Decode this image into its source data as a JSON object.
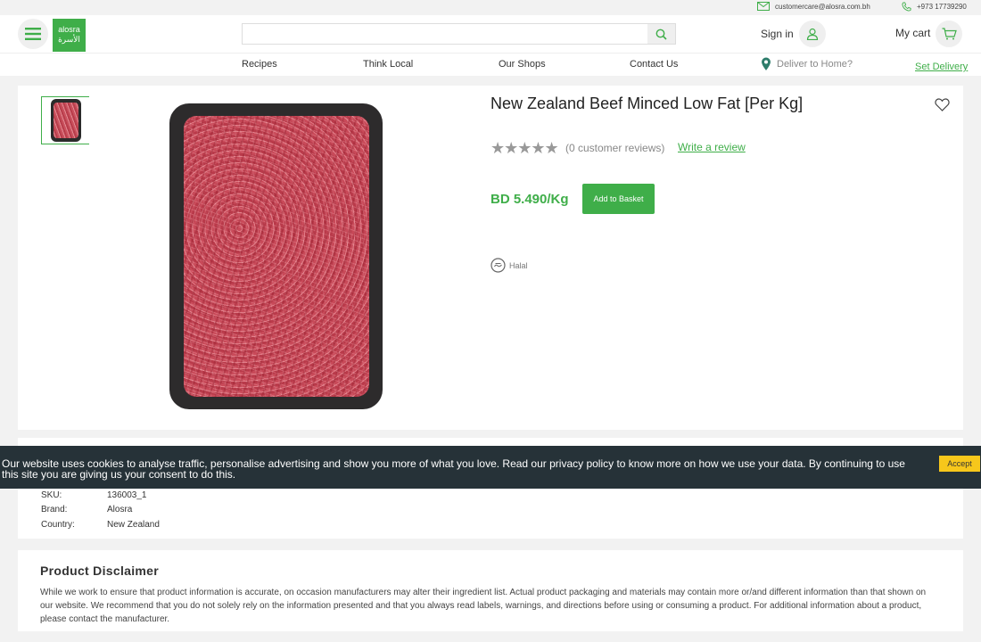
{
  "topbar": {
    "email": "customercare@alosra.com.bh",
    "phone": "+973 17739290",
    "email_icon": "mail-icon",
    "phone_icon": "phone-icon"
  },
  "header": {
    "logo_text_en": "alosra",
    "logo_text_ar": "الأسرة",
    "search_placeholder": "",
    "signin_label": "Sign in",
    "cart_label": "My cart"
  },
  "nav": {
    "items": [
      {
        "label": "Recipes"
      },
      {
        "label": "Think Local"
      },
      {
        "label": "Our Shops"
      },
      {
        "label": "Contact Us"
      }
    ],
    "deliver_label": "Deliver to Home?",
    "set_delivery_label": "Set Delivery"
  },
  "product": {
    "title": "New Zealand Beef Minced Low Fat [Per Kg]",
    "stars": "★★★★★",
    "rating": 0,
    "reviews_text": "(0 customer reviews)",
    "write_review": "Write a review",
    "price": "BD 5.490/Kg",
    "add_to_basket": "Add to Basket",
    "badge": "Halal"
  },
  "details": {
    "rows": [
      {
        "key": "SKU:",
        "value": "136003_1"
      },
      {
        "key": "Brand:",
        "value": "Alosra"
      },
      {
        "key": "Country:",
        "value": "New Zealand"
      }
    ]
  },
  "disclaimer": {
    "title": "Product Disclaimer",
    "text": "While we work to ensure that product information is accurate, on occasion manufacturers may alter their ingredient list. Actual product packaging and materials may contain more or/and different information than that shown on our website. We recommend that you do not solely rely on the information presented and that you always read labels, warnings, and directions before using or consuming a product. For additional information about a product, please contact the manufacturer."
  },
  "cookie": {
    "text": "Our website uses cookies to analyse traffic, personalise advertising and show you more of what you love. Read our privacy policy to know more on how we use your data. By continuing to use this site you are giving us your consent to do this.",
    "accept_label": "Accept"
  },
  "colors": {
    "brand_green": "#3fae49",
    "cookie_bg": "#263238",
    "accept_yellow": "#f7c71b"
  }
}
